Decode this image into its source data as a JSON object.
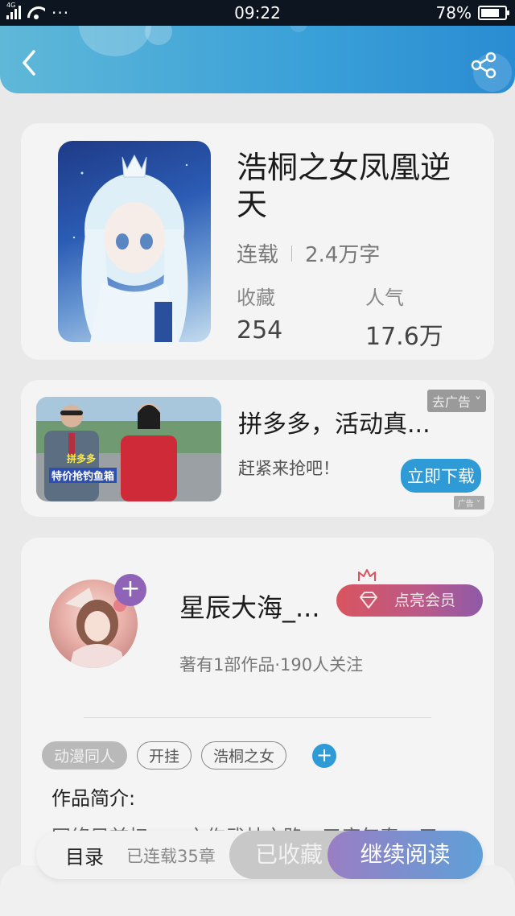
{
  "status_bar": {
    "network": "4G",
    "dots": "···",
    "time": "09:22",
    "battery": "78%",
    "battery_level": 0.78
  },
  "header": {
    "back_icon": "chevron-left-icon",
    "share_icon": "share-icon"
  },
  "book": {
    "title": "浩桐之女凤凰逆天",
    "status": "连载",
    "word_count": "2.4万字",
    "favorites_label": "收藏",
    "favorites_value": "254",
    "popularity_label": "人气",
    "popularity_value": "17.6万"
  },
  "ad": {
    "title": "拼多多，活动真...",
    "subtitle": "赶紧来抢吧！",
    "close_label": "去广告",
    "download_label": "立即下载",
    "ad_tag": "广告",
    "image_caption_line1": "拼多多",
    "image_caption_line2": "特价抢钓鱼箱"
  },
  "author": {
    "name": "星辰大海_...",
    "vip_label": "点亮会员",
    "stats": "著有1部作品·190人关注",
    "follow_label": "+"
  },
  "tags": [
    {
      "label": "动漫同人"
    },
    {
      "label": "开挂"
    },
    {
      "label": "浩桐之女"
    }
  ],
  "tag_add_label": "+",
  "intro": {
    "title": "作品简介:",
    "text": "网络目前扫……之作武林之路，三度年春，三"
  },
  "bottom_bar": {
    "toc_label": "目录",
    "chapter_status": "已连载35章",
    "favorite_label": "已收藏",
    "read_label": "继续阅读"
  },
  "colors": {
    "header_blue": "#3aa0d8",
    "accent_blue": "#2e9ad6",
    "vip_red": "#d9545e",
    "plus_purple": "#8e63b8"
  }
}
